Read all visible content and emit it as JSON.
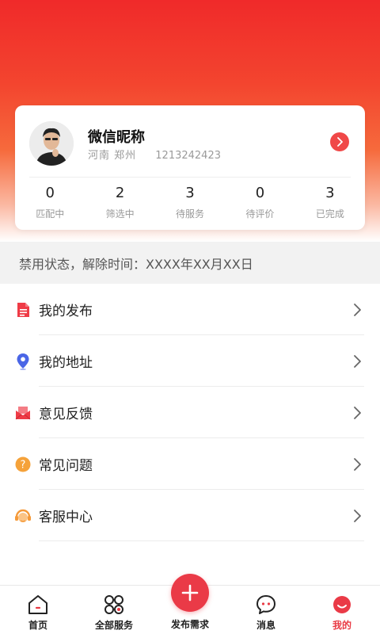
{
  "profile": {
    "nickname": "微信昵称",
    "region": "河南 郑州",
    "phone": "1213242423",
    "stats": [
      {
        "value": "0",
        "label": "匹配中"
      },
      {
        "value": "2",
        "label": "筛选中"
      },
      {
        "value": "3",
        "label": "待服务"
      },
      {
        "value": "0",
        "label": "待评价"
      },
      {
        "value": "3",
        "label": "已完成"
      }
    ]
  },
  "notice": "禁用状态，解除时间：XXXX年XX月XX日",
  "menu": [
    {
      "label": "我的发布",
      "icon": "document-icon",
      "color": "#ef3b46"
    },
    {
      "label": "我的地址",
      "icon": "location-pin-icon",
      "color": "#4a66e6"
    },
    {
      "label": "意见反馈",
      "icon": "envelope-icon",
      "color": "#ef3b46"
    },
    {
      "label": "常见问题",
      "icon": "question-icon",
      "color": "#f5a23a"
    },
    {
      "label": "客服中心",
      "icon": "headset-icon",
      "color": "#f59a3a"
    }
  ],
  "tabbar": {
    "home": "首页",
    "services": "全部服务",
    "publish": "发布需求",
    "messages": "消息",
    "mine": "我的"
  },
  "colors": {
    "accent": "#ea3a47",
    "hero_top": "#f02a2a"
  }
}
